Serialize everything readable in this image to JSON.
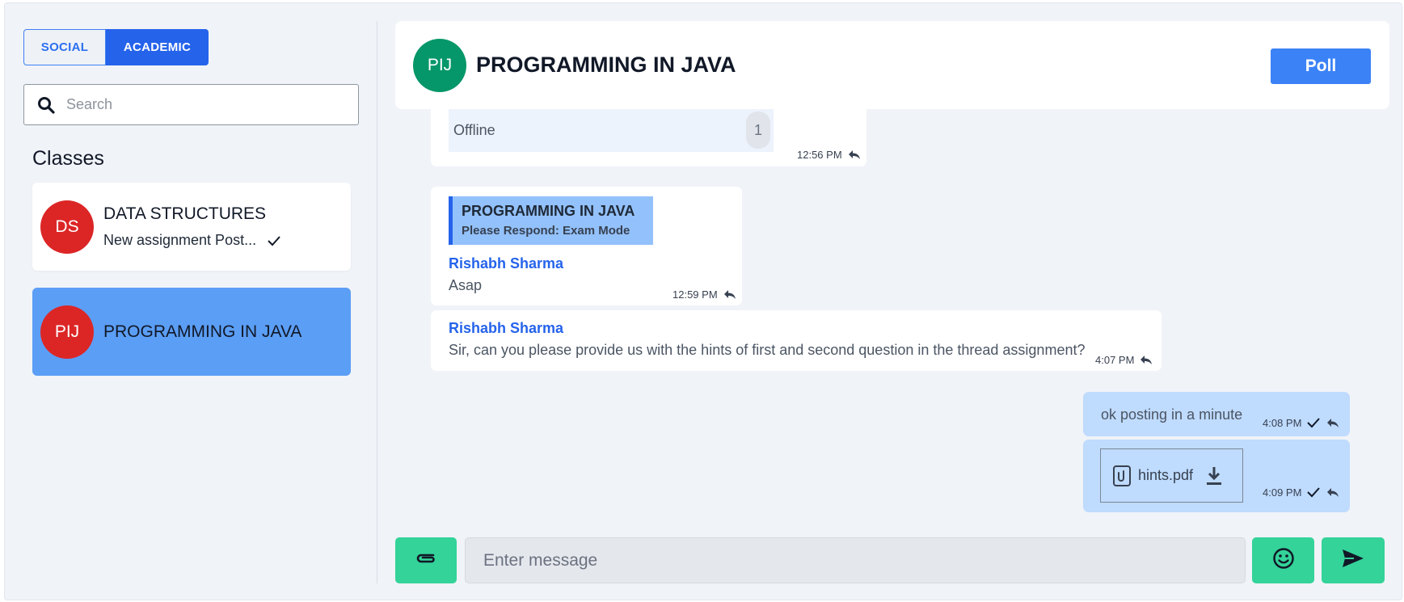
{
  "sidebar": {
    "tabs": [
      {
        "label": "SOCIAL",
        "active": false
      },
      {
        "label": "ACADEMIC",
        "active": true
      }
    ],
    "search": {
      "placeholder": "Search",
      "icon": "search-icon"
    },
    "classes_heading": "Classes",
    "classes": [
      {
        "initials": "DS",
        "name": "DATA STRUCTURES",
        "last_message": "New assignment Post...",
        "status_icon": "check-icon",
        "avatar_color": "#dc2626",
        "selected": false
      },
      {
        "initials": "PIJ",
        "name": "PROGRAMMING IN JAVA",
        "avatar_color": "#dc2626",
        "selected": true
      }
    ]
  },
  "chat": {
    "header": {
      "initials": "PIJ",
      "title": "PROGRAMMING IN JAVA",
      "avatar_color": "#059669",
      "poll_label": "Poll"
    },
    "messages": [
      {
        "type": "poll",
        "option_label": "Offline",
        "option_count": "1",
        "time": "12:56 PM"
      },
      {
        "type": "reply",
        "quote_title": "PROGRAMMING IN JAVA",
        "quote_subtitle": "Please Respond: Exam Mode",
        "sender": "Rishabh Sharma",
        "text": "Asap",
        "time": "12:59 PM"
      },
      {
        "type": "text",
        "sender": "Rishabh Sharma",
        "text": "Sir, can you please provide us with the hints of first and second question in the thread assignment?",
        "time": "4:07 PM"
      },
      {
        "type": "outgoing-text",
        "text": "ok posting in a minute",
        "time": "4:08 PM"
      },
      {
        "type": "outgoing-file",
        "file_name": "hints.pdf",
        "time": "4:09 PM"
      }
    ],
    "composer": {
      "placeholder": "Enter message"
    }
  },
  "colors": {
    "accent": "#2563eb",
    "selected_class": "#5b9ef5",
    "outgoing_bubble": "#bfdbfe",
    "action_green": "#34d399",
    "poll_button": "#3b82f6"
  }
}
